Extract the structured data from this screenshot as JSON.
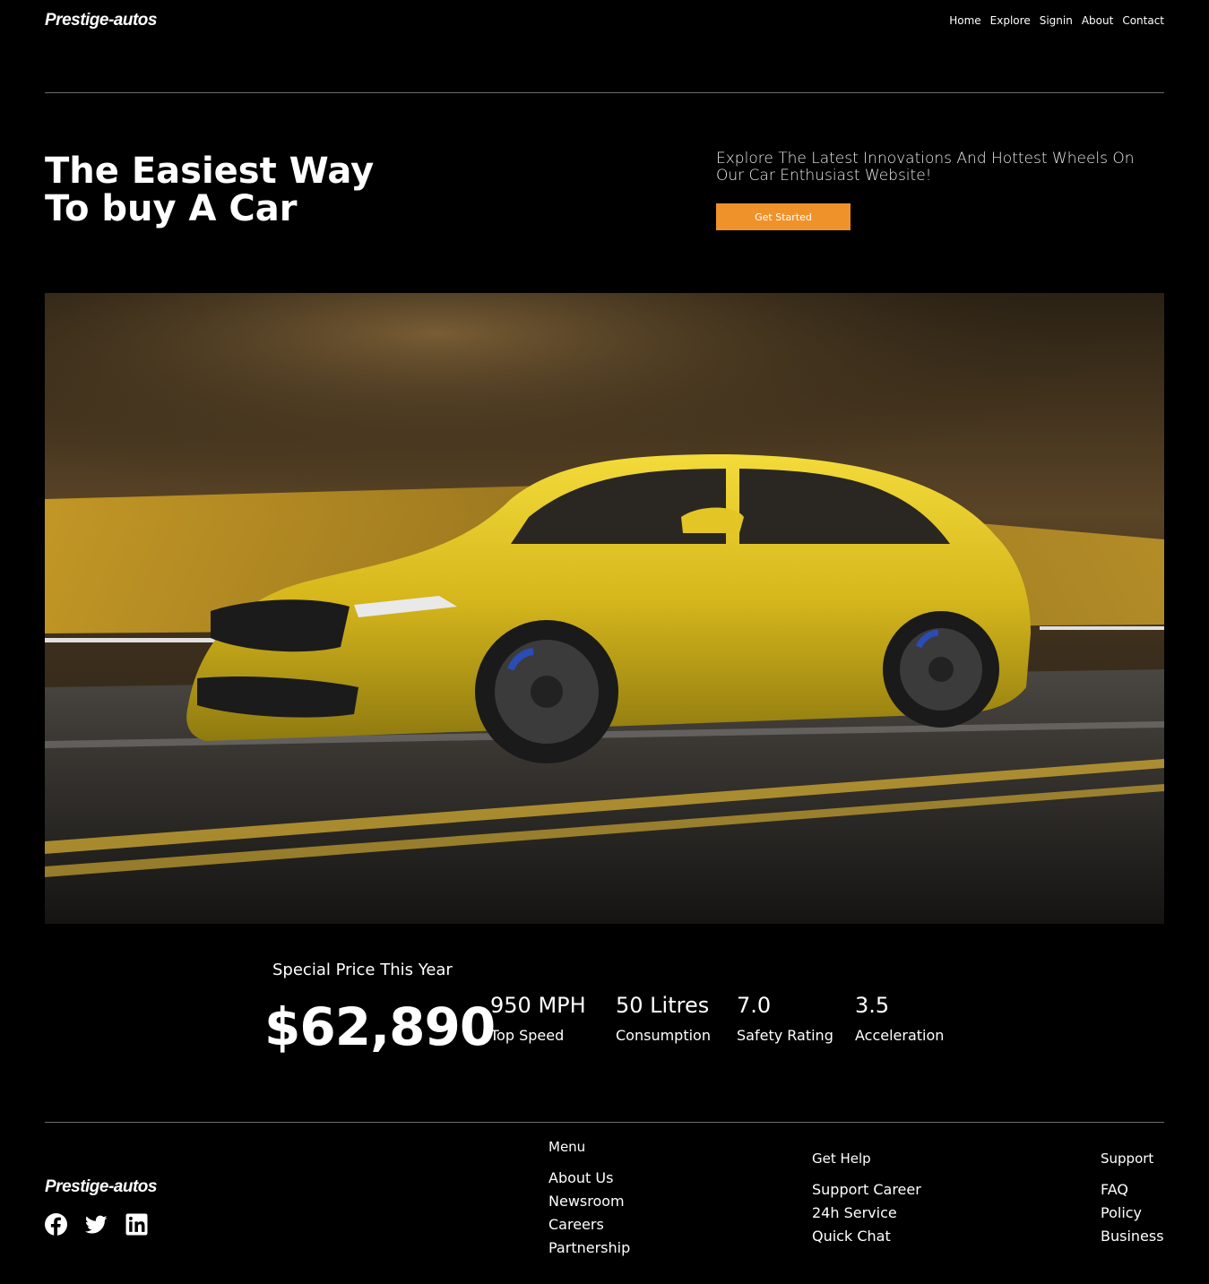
{
  "header": {
    "logo": "Prestige-autos",
    "nav": [
      "Home",
      "Explore",
      "Signin",
      "About",
      "Contact"
    ]
  },
  "hero": {
    "title_line1": "The Easiest Way",
    "title_line2": "To buy A Car",
    "subtitle": "Explore The Latest Innovations And Hottest Wheels On Our Car Enthusiast Website!",
    "cta_label": "Get Started",
    "accent_color": "#f0922a"
  },
  "pricing": {
    "caption": "Special Price This Year",
    "price": "$62,890",
    "stats": [
      {
        "value": "950 MPH",
        "label": "Top Speed"
      },
      {
        "value": "50 Litres",
        "label": "Consumption"
      },
      {
        "value": "7.0",
        "label": "Safety Rating"
      },
      {
        "value": "3.5",
        "label": "Acceleration"
      }
    ]
  },
  "footer": {
    "logo": "Prestige-autos",
    "socials": [
      "facebook-icon",
      "twitter-icon",
      "linkedin-icon"
    ],
    "menu": {
      "heading": "Menu",
      "links": [
        "About Us",
        "Newsroom",
        "Careers",
        "Partnership"
      ]
    },
    "help": {
      "heading": "Get Help",
      "links": [
        "Support Career",
        "24h Service",
        "Quick Chat"
      ]
    },
    "support": {
      "heading": "Support",
      "links": [
        "FAQ",
        "Policy",
        "Business"
      ]
    }
  }
}
